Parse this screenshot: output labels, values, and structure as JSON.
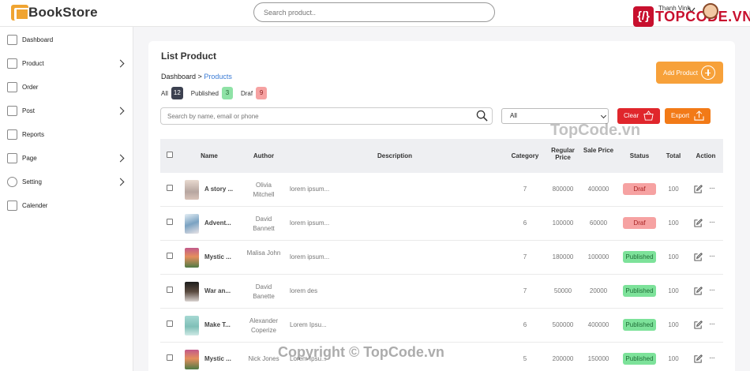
{
  "header": {
    "logo_text": "BookStore",
    "search_placeholder": "Search product..",
    "user_name": "Thanh Vinh",
    "brand_text": "TOPCODE.VN"
  },
  "sidebar": {
    "items": [
      {
        "label": "Dashboard",
        "icon": "home-icon",
        "has_children": false
      },
      {
        "label": "Product",
        "icon": "box-icon",
        "has_children": true
      },
      {
        "label": "Order",
        "icon": "clipboard-icon",
        "has_children": false
      },
      {
        "label": "Post",
        "icon": "post-icon",
        "has_children": true
      },
      {
        "label": "Reports",
        "icon": "report-icon",
        "has_children": false
      },
      {
        "label": "Page",
        "icon": "page-icon",
        "has_children": true
      },
      {
        "label": "Setting",
        "icon": "gear-icon",
        "has_children": true
      },
      {
        "label": "Calender",
        "icon": "calendar-icon",
        "has_children": false
      }
    ]
  },
  "main": {
    "title": "List Product",
    "add_button": "Add Product",
    "breadcrumb": {
      "root": "Dashboard",
      "separator": ">",
      "current": "Products"
    },
    "filters": [
      {
        "label": "All",
        "count": "12"
      },
      {
        "label": "Published",
        "count": "3"
      },
      {
        "label": "Draf",
        "count": "9"
      }
    ],
    "search_placeholder": "Search by name, email or phone",
    "select_value": "All",
    "clear_button": "Clear",
    "export_button": "Export",
    "table": {
      "columns": {
        "name": "Name",
        "author": "Author",
        "description": "Description",
        "category": "Category",
        "regular_price": "Regular Price",
        "sale_price": "Sale Price",
        "status": "Status",
        "total": "Total",
        "action": "Action"
      },
      "rows": [
        {
          "name": "A story ...",
          "author": "Olivia Mitchell",
          "description": "lorem ipsum...",
          "category": "7",
          "regular_price": "800000",
          "sale_price": "400000",
          "status": "Draf",
          "total": "100"
        },
        {
          "name": "Advent...",
          "author": "David Bannett",
          "description": "lorem ipsum...",
          "category": "6",
          "regular_price": "100000",
          "sale_price": "60000",
          "status": "Draf",
          "total": "100"
        },
        {
          "name": "Mystic ...",
          "author": "Malisa John",
          "description": "lorem ipsum...",
          "category": "7",
          "regular_price": "180000",
          "sale_price": "100000",
          "status": "Published",
          "total": "100"
        },
        {
          "name": "War an...",
          "author": "David Banette",
          "description": "lorem des",
          "category": "7",
          "regular_price": "50000",
          "sale_price": "20000",
          "status": "Published",
          "total": "100"
        },
        {
          "name": "Make T...",
          "author": "Alexander Coperize",
          "description": "Lorem Ipsu...",
          "category": "6",
          "regular_price": "500000",
          "sale_price": "400000",
          "status": "Published",
          "total": "100"
        },
        {
          "name": "Mystic ...",
          "author": "Nick Jones",
          "description": "Lorem Ipsu...",
          "category": "5",
          "regular_price": "200000",
          "sale_price": "150000",
          "status": "Published",
          "total": "100"
        }
      ]
    }
  },
  "watermark": "TopCode.vn",
  "copyright": "Copyright © TopCode.vn",
  "colors": {
    "accent_orange": "#f7a13a",
    "clear_red": "#e0262c",
    "export_orange": "#f27a17",
    "draf_bg": "#f6a2a2",
    "published_bg": "#7de29a",
    "link_blue": "#3a7bd5"
  }
}
